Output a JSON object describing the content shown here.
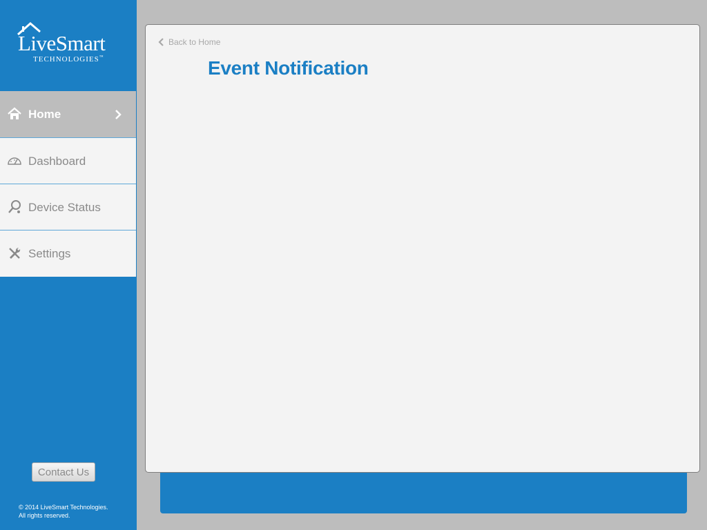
{
  "brand": {
    "name": "LiveSmart",
    "tagline": "TECHNOLOGIES",
    "tm": "™"
  },
  "sidebar": {
    "items": [
      {
        "label": "Home",
        "icon": "home-icon",
        "active": true
      },
      {
        "label": "Dashboard",
        "icon": "gauge-icon",
        "active": false
      },
      {
        "label": "Device Status",
        "icon": "device-search-icon",
        "active": false
      },
      {
        "label": "Settings",
        "icon": "tools-icon",
        "active": false
      }
    ],
    "contact_label": "Contact Us",
    "copyright_line1": "© 2014 LiveSmart Technologies.",
    "copyright_line2": "All rights reserved."
  },
  "main": {
    "back_label": "Back to Home",
    "title": "Event Notification"
  },
  "colors": {
    "brand_blue": "#1b7fc4",
    "panel_bg": "#f3f3f3",
    "page_bg": "#bdbdbd"
  }
}
